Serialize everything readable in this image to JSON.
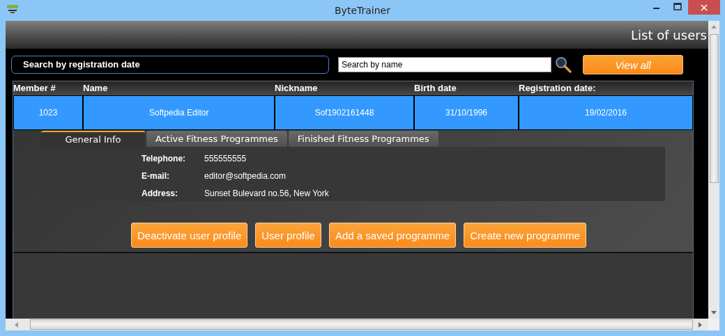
{
  "window": {
    "title": "ByteTrainer"
  },
  "header": {
    "title": "List of users"
  },
  "search": {
    "registration_date": "Search by registration date",
    "name_placeholder": "Search by name",
    "view_all": "View all"
  },
  "table": {
    "columns": [
      "Member #",
      "Name",
      "Nickname",
      "Birth date",
      "Registration date:"
    ],
    "rows": [
      {
        "selected": true,
        "cells": [
          "1023",
          "Softpedia Editor",
          "Sof1902161448",
          "31/10/1996",
          "19/02/2016"
        ]
      }
    ]
  },
  "tabs": [
    {
      "label": "General Info",
      "selected": true
    },
    {
      "label": "Active Fitness Programmes",
      "selected": false
    },
    {
      "label": "Finished Fitness Programmes",
      "selected": false
    }
  ],
  "info": [
    {
      "label": "Telephone:",
      "value": "555555555"
    },
    {
      "label": "E-mail:",
      "value": "editor@softpedia.com"
    },
    {
      "label": "Address:",
      "value": "Sunset Bulevard no.56, New York"
    }
  ],
  "actions": [
    "Deactivate user profile",
    "User profile",
    "Add a saved programme",
    "Create new programme"
  ]
}
